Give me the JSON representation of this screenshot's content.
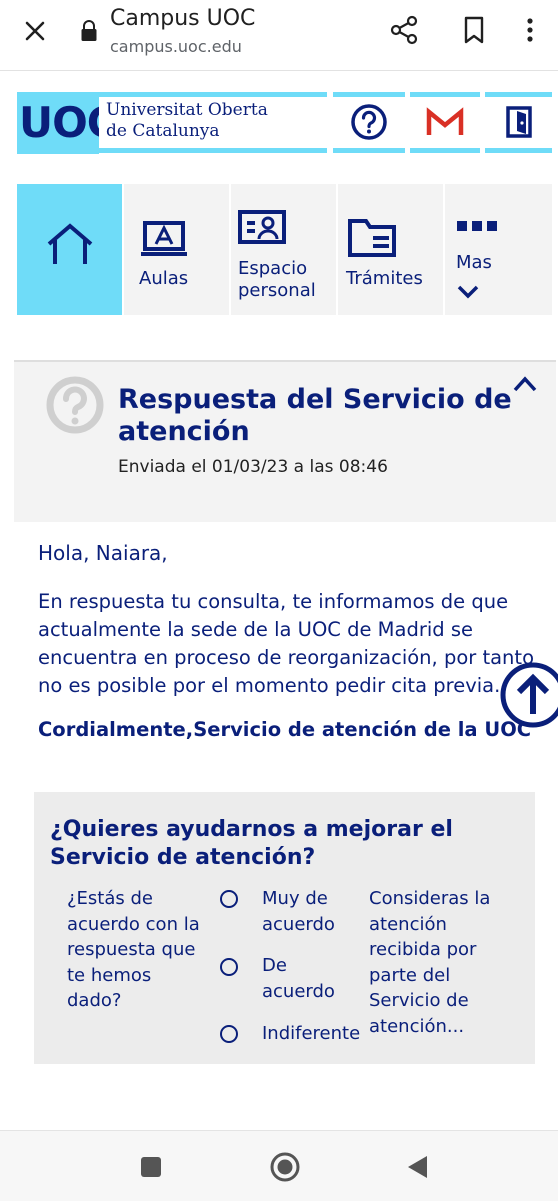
{
  "browser": {
    "title": "Campus UOC",
    "url": "campus.uoc.edu",
    "icons": [
      "close-icon",
      "lock-icon",
      "share-icon",
      "bookmark-icon",
      "more-vert-icon"
    ]
  },
  "header": {
    "logo_text": "UOC",
    "university_line1": "Universitat Oberta",
    "university_line2": "de Catalunya",
    "icons": [
      "help-icon",
      "mail-icon",
      "logout-icon"
    ]
  },
  "nav": {
    "items": [
      {
        "label": "",
        "icon": "home-icon"
      },
      {
        "label": "Aulas",
        "icon": "classroom-icon"
      },
      {
        "label_line1": "Espacio",
        "label_line2": "personal",
        "icon": "profile-icon"
      },
      {
        "label": "Trámites",
        "icon": "folder-icon"
      },
      {
        "label": "Mas",
        "icon": "more-icon"
      }
    ]
  },
  "message": {
    "title": "Respuesta del Servicio de atención",
    "date": "Enviada el 01/03/23 a las 08:46",
    "greeting": "Hola, Naiara,",
    "body": "En respuesta tu consulta, te informamos de que actualmente la sede de la UOC de Madrid se encuentra en proceso de reorganización, por tanto no es posible por el momento pedir cita previa.",
    "signoff": "Cordialmente,Servicio de atención de la UOC"
  },
  "survey": {
    "title": "¿Quieres ayudarnos a mejorar el Servicio de atención?",
    "question": "¿Estás de acuerdo con la respuesta que te hemos dado?",
    "options": [
      "Muy de acuerdo",
      "De acuerdo",
      "Indiferente"
    ],
    "question2": "Consideras la atención recibida por parte del Servicio de atención..."
  },
  "colors": {
    "brand_navy": "#0a1f7a",
    "brand_cyan": "#6fdcf8",
    "gmail_red": "#d93025"
  }
}
